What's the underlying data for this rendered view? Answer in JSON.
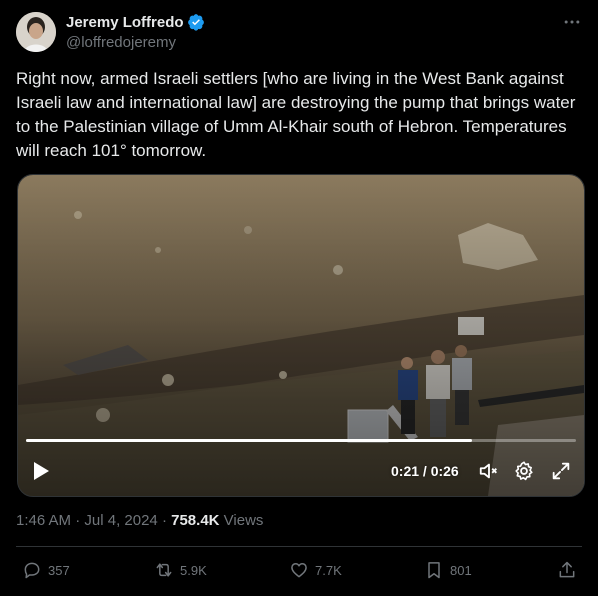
{
  "author": {
    "name": "Jeremy Loffredo",
    "handle": "@loffredojeremy",
    "verified": true
  },
  "tweet": {
    "text": "Right now, armed Israeli settlers [who are living in the West Bank against Israeli law and international law] are destroying the pump that brings water to the Palestinian village of Umm Al-Khair south of Hebron. Temperatures will reach 101° tomorrow.",
    "time": "1:46 AM",
    "separator": "·",
    "date": "Jul 4, 2024",
    "views_count": "758.4K",
    "views_label": "Views"
  },
  "video": {
    "current_time": "0:21",
    "duration": "0:26",
    "time_display": "0:21 / 0:26",
    "progress": 0.81
  },
  "actions": {
    "replies": "357",
    "reposts": "5.9K",
    "likes": "7.7K",
    "bookmarks": "801"
  },
  "colors": {
    "background": "#000000",
    "text": "#e7e9ea",
    "muted": "#71767b",
    "verified": "#1d9bf0"
  }
}
